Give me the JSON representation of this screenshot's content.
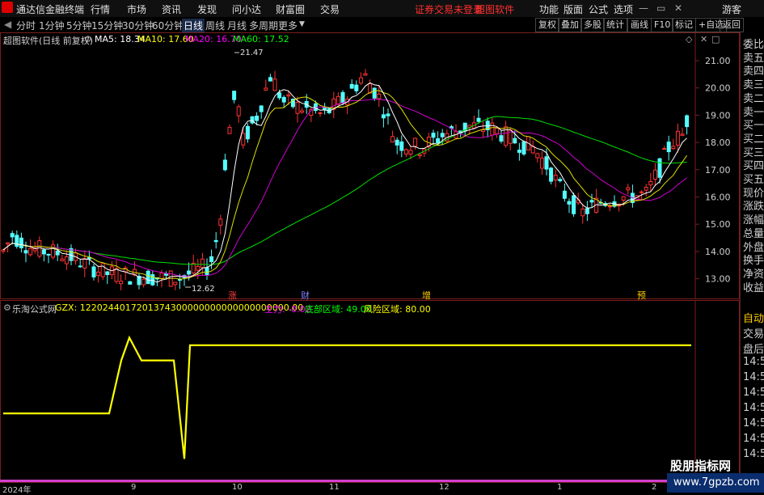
{
  "menubar": {
    "app_title": "通达信金融终端",
    "items": [
      "行情",
      "市场",
      "资讯",
      "发现",
      "问小达",
      "财富圈",
      "交易"
    ],
    "status": "证券交易未登录",
    "status_app": "超图软件",
    "right_items": [
      "功能",
      "版面",
      "公式",
      "选项"
    ],
    "user": "游客"
  },
  "tabs": {
    "periods": [
      "分时",
      "1分钟",
      "5分钟",
      "15分钟",
      "30分钟",
      "60分钟",
      "日线",
      "周线",
      "月线",
      "多周期",
      "更多"
    ],
    "active": "日线",
    "tools": [
      "复权",
      "叠加",
      "多股",
      "统计",
      "画线",
      "F10",
      "标记",
      "+自选",
      "返回"
    ]
  },
  "main_chart": {
    "stock_label": "超图软件(日线 前复权)",
    "ma5_label": "MA5: 18.34",
    "ma10_label": "MA10: 17.60",
    "ma20_label": "MA20: 16.70",
    "ma60_label": "MA60: 17.52",
    "high_label": "21.47",
    "low_label": "12.62",
    "price_ticks": [
      "21.00",
      "20.00",
      "19.00",
      "18.00",
      "17.00",
      "16.00",
      "15.00",
      "14.00",
      "13.00"
    ],
    "markers": [
      "涨",
      "财",
      "增",
      "预"
    ]
  },
  "indicator": {
    "name": "乐淘公式网",
    "gzx": "GZX: 1220244017201374300000000000000000000.00",
    "zhuli": "主力: -0.02",
    "dibu": "底部区域: 49.00",
    "fengxian": "风险区域: 80.00"
  },
  "right_panel": {
    "items": [
      "委比",
      "卖五",
      "卖四",
      "卖三",
      "卖二",
      "卖一",
      "买一",
      "买二",
      "买三",
      "买四",
      "买五",
      "现价",
      "涨跌",
      "涨幅",
      "总量",
      "外盘",
      "换手",
      "净资",
      "收益"
    ],
    "items2": [
      "自动",
      "交易",
      "盘后",
      "14:5",
      "14:5",
      "14:5",
      "14:5",
      "14:5",
      "14:5",
      "14:5"
    ]
  },
  "date_axis": [
    "2024年",
    "9",
    "10",
    "11",
    "12",
    "1",
    "2"
  ],
  "watermark": {
    "line1": "股朋指标网",
    "line2": "www.7gpzb.com"
  },
  "colors": {
    "up": "#ff3232",
    "down": "#54ffff",
    "ma5": "#ffffff",
    "ma10": "#ffff00",
    "ma20": "#ff00ff",
    "ma60": "#00ff00",
    "indicator": "#ffff00"
  }
}
